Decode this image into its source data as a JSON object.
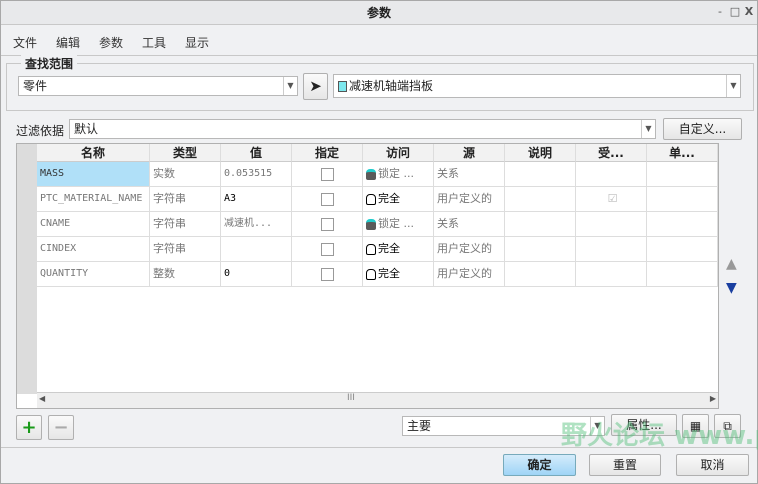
{
  "window": {
    "title": "参数",
    "min": "-",
    "max": "□",
    "close": "X"
  },
  "menu": [
    "文件",
    "编辑",
    "参数",
    "工具",
    "显示"
  ],
  "scope": {
    "legend": "查找范围",
    "type": "零件",
    "object": "减速机轴端挡板"
  },
  "filter": {
    "label": "过滤依据",
    "value": "默认",
    "custom_button": "自定义..."
  },
  "table": {
    "headers": [
      "名称",
      "类型",
      "值",
      "指定",
      "访问",
      "源",
      "说明",
      "受...",
      "单..."
    ],
    "rows": [
      {
        "name": "MASS",
        "type": "实数",
        "value": "0.053515",
        "access": "锁定 ...",
        "access_icon": "locked-icon",
        "source": "关系",
        "restricted": false
      },
      {
        "name": "PTC_MATERIAL_NAME",
        "type": "字符串",
        "value": "A3",
        "access": "完全",
        "access_icon": "full-access-icon",
        "source": "用户定义的",
        "restricted": true
      },
      {
        "name": "CNAME",
        "type": "字符串",
        "value": "减速机...",
        "access": "锁定 ...",
        "access_icon": "locked-icon",
        "source": "关系",
        "restricted": false
      },
      {
        "name": "CINDEX",
        "type": "字符串",
        "value": "",
        "access": "完全",
        "access_icon": "full-access-icon",
        "source": "用户定义的",
        "restricted": false
      },
      {
        "name": "QUANTITY",
        "type": "整数",
        "value": "0",
        "access": "完全",
        "access_icon": "full-access-icon",
        "source": "用户定义的",
        "restricted": false
      }
    ],
    "scroll_grip": "III"
  },
  "bottom": {
    "add": "+",
    "remove": "−",
    "view": "主要",
    "properties": "属性..."
  },
  "footer": {
    "ok": "确定",
    "reset": "重置",
    "cancel": "取消"
  },
  "watermark": "野火论坛 www.proewildfire.cn"
}
